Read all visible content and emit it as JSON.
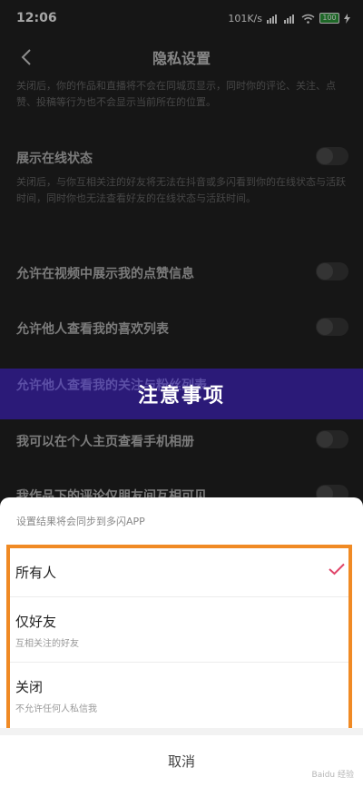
{
  "status_bar": {
    "time": "12:06",
    "speed": "101K/s",
    "battery": "100"
  },
  "nav": {
    "title": "隐私设置"
  },
  "settings": {
    "intro_desc": "关闭后，你的作品和直播将不会在同城页显示，同时你的评论、关注、点赞、投稿等行为也不会显示当前所在的位置。",
    "online_title": "展示在线状态",
    "online_desc": "关闭后，与你互相关注的好友将无法在抖音或多闪看到你的在线状态与活跃时间，同时你也无法查看好友的在线状态与活跃时间。",
    "likes_title": "允许在视频中展示我的点赞信息",
    "favorites_title": "允许他人查看我的喜欢列表",
    "follow_title": "允许他人查看我的关注与粉丝列表",
    "album_title": "我可以在个人主页查看手机相册",
    "comments_title": "我作品下的评论仅朋友间互相可见"
  },
  "banner": {
    "text": "注意事项"
  },
  "sheet": {
    "hint": "设置结果将会同步到多闪APP",
    "options": [
      {
        "title": "所有人",
        "subtitle": "",
        "selected": true
      },
      {
        "title": "仅好友",
        "subtitle": "互相关注的好友",
        "selected": false
      },
      {
        "title": "关闭",
        "subtitle": "不允许任何人私信我",
        "selected": false
      }
    ],
    "cancel_label": "取消"
  },
  "watermark": "Baidu 经验",
  "colors": {
    "highlight": "#f08a24",
    "check": "#e0456a",
    "banner": "#2b1a78"
  }
}
